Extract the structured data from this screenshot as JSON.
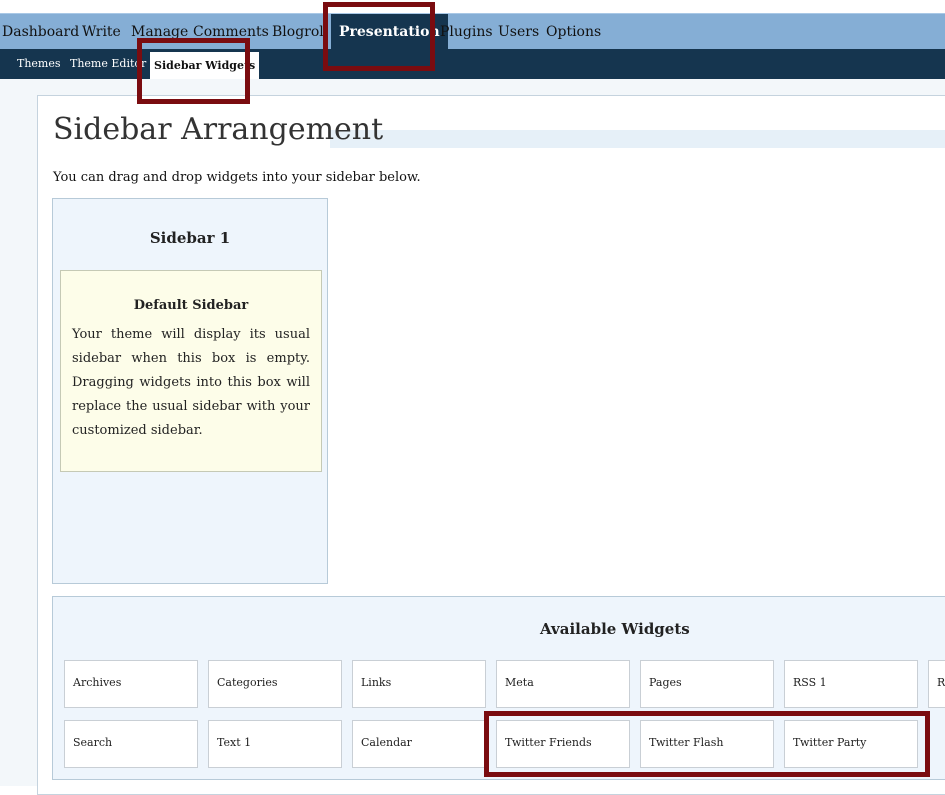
{
  "nav": {
    "main": [
      "Dashboard",
      "Write",
      "Manage",
      "Comments",
      "Blogroll",
      "Presentation",
      "Plugins",
      "Users",
      "Options"
    ],
    "active_main": "Presentation",
    "sub": [
      "Themes",
      "Theme Editor",
      "Sidebar Widgets"
    ],
    "active_sub": "Sidebar Widgets"
  },
  "page": {
    "title": "Sidebar Arrangement",
    "intro": "You can drag and drop widgets into your sidebar below."
  },
  "sidebar": {
    "title": "Sidebar 1",
    "default_title": "Default Sidebar",
    "default_text": "Your theme will display its usual sidebar when this box is empty. Dragging widgets into this box will replace the usual sidebar with your customized sidebar."
  },
  "widgets": {
    "title": "Available Widgets",
    "row1": [
      "Archives",
      "Categories",
      "Links",
      "Meta",
      "Pages",
      "RSS 1",
      "R"
    ],
    "row2": [
      "Search",
      "Text 1",
      "Calendar",
      "Twitter Friends",
      "Twitter Flash",
      "Twitter Party"
    ]
  },
  "colors": {
    "nav_bg": "#85aed5",
    "nav_active": "#15354f",
    "highlight": "#7a0c10"
  }
}
